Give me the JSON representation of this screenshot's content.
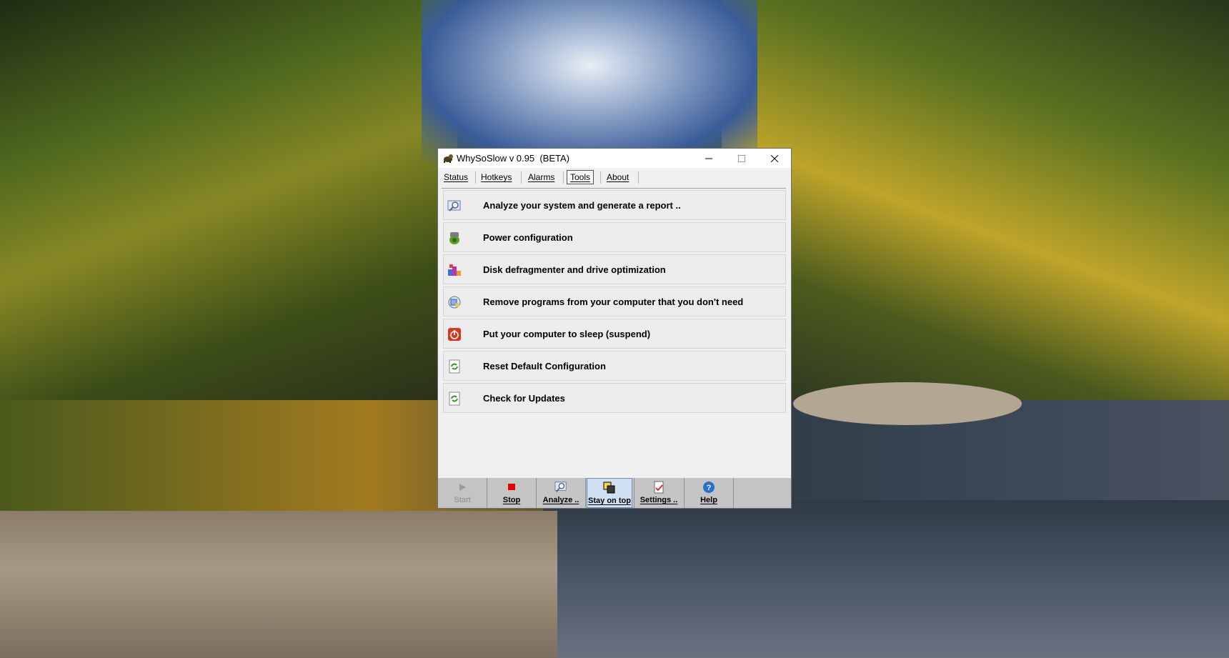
{
  "window": {
    "title": "WhySoSlow v 0.95  (BETA)"
  },
  "menu": {
    "items": [
      "Status",
      "Hotkeys",
      "Alarms",
      "Tools",
      "About"
    ],
    "active": "Tools"
  },
  "tools": {
    "items": [
      {
        "label": "Analyze your system and generate a report ..",
        "icon": "magnifier-report-icon"
      },
      {
        "label": "Power configuration",
        "icon": "power-plug-icon"
      },
      {
        "label": "Disk defragmenter and drive optimization",
        "icon": "defrag-icon"
      },
      {
        "label": "Remove programs from your computer that you don't need",
        "icon": "uninstall-programs-icon"
      },
      {
        "label": "Put your computer to sleep (suspend)",
        "icon": "power-off-icon"
      },
      {
        "label": "Reset Default Configuration",
        "icon": "refresh-icon"
      },
      {
        "label": "Check for Updates",
        "icon": "refresh-icon"
      }
    ]
  },
  "toolbar": {
    "start": "Start",
    "stop": "Stop",
    "analyze": "Analyze ..",
    "stay_on_top": "Stay on top",
    "settings": "Settings ..",
    "help": "Help"
  },
  "colors": {
    "window_bg": "#f0f0f0",
    "toolbar_bg": "#c4c4c4",
    "stop_red": "#e30000",
    "help_blue": "#2a6fd1",
    "pressed_bg": "#cfe0f3"
  }
}
